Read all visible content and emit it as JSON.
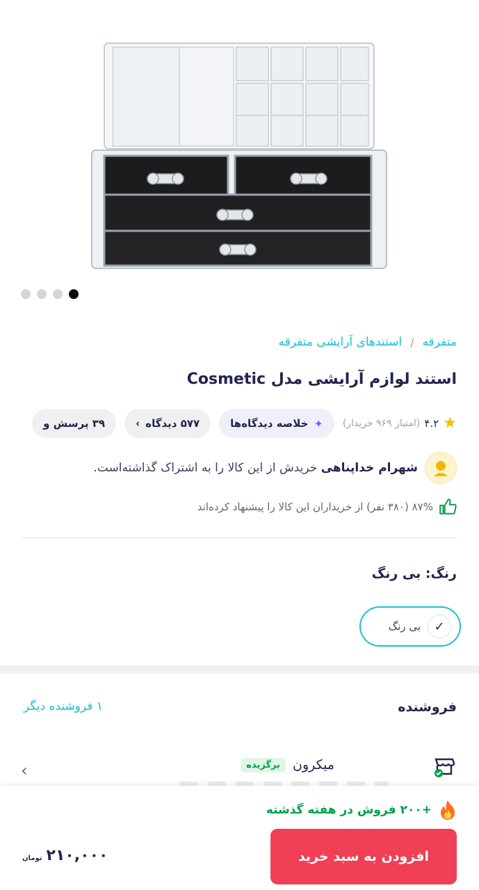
{
  "gallery": {
    "slide_count": 4,
    "active_index": 3
  },
  "breadcrumb": {
    "items": [
      "متفرقه",
      "استندهای آرایشی متفرقه"
    ],
    "separator": "/"
  },
  "product": {
    "title": "استند لوازم آرایشی مدل Cosmetic"
  },
  "meta": {
    "rating_score": "۴.۲",
    "rating_count": "(امتیاز ۹۶۹ خریدار)",
    "summary_chip": "خلاصه دیدگاه‌ها",
    "reviews_chip": "۵۷۷ دیدگاه",
    "questions_chip": "۳۹ پرسش و"
  },
  "share": {
    "name": "شهرام خداپناهی",
    "text": " خریدش از این کالا را به اشتراک گذاشته‌است."
  },
  "recommend": {
    "text": "۸۷% (۳۸۰ نفر) از خریداران این کالا را پیشنهاد کرده‌اند"
  },
  "color": {
    "label": "رنگ: بی رنگ",
    "option": "بی رنگ"
  },
  "seller": {
    "heading": "فروشنده",
    "other_sellers": "۱ فروشنده دیگر",
    "name": "میکرون",
    "badge": "برگزیده"
  },
  "bottom": {
    "sales_text": "+۲۰۰ فروش در هفته گذشته",
    "add_to_cart": "افزودن به سبد خرید",
    "price": "۲۱۰,۰۰۰",
    "currency": "تومان"
  },
  "colors": {
    "accent": "#19bfd3",
    "primary": "#ef4056",
    "success": "#00a049",
    "star": "#f9bc00"
  },
  "icons": [
    "star-icon",
    "sparkle-icon",
    "chevron-left-icon",
    "avatar-icon",
    "thumbs-up-icon",
    "check-icon",
    "store-icon",
    "fire-icon"
  ]
}
